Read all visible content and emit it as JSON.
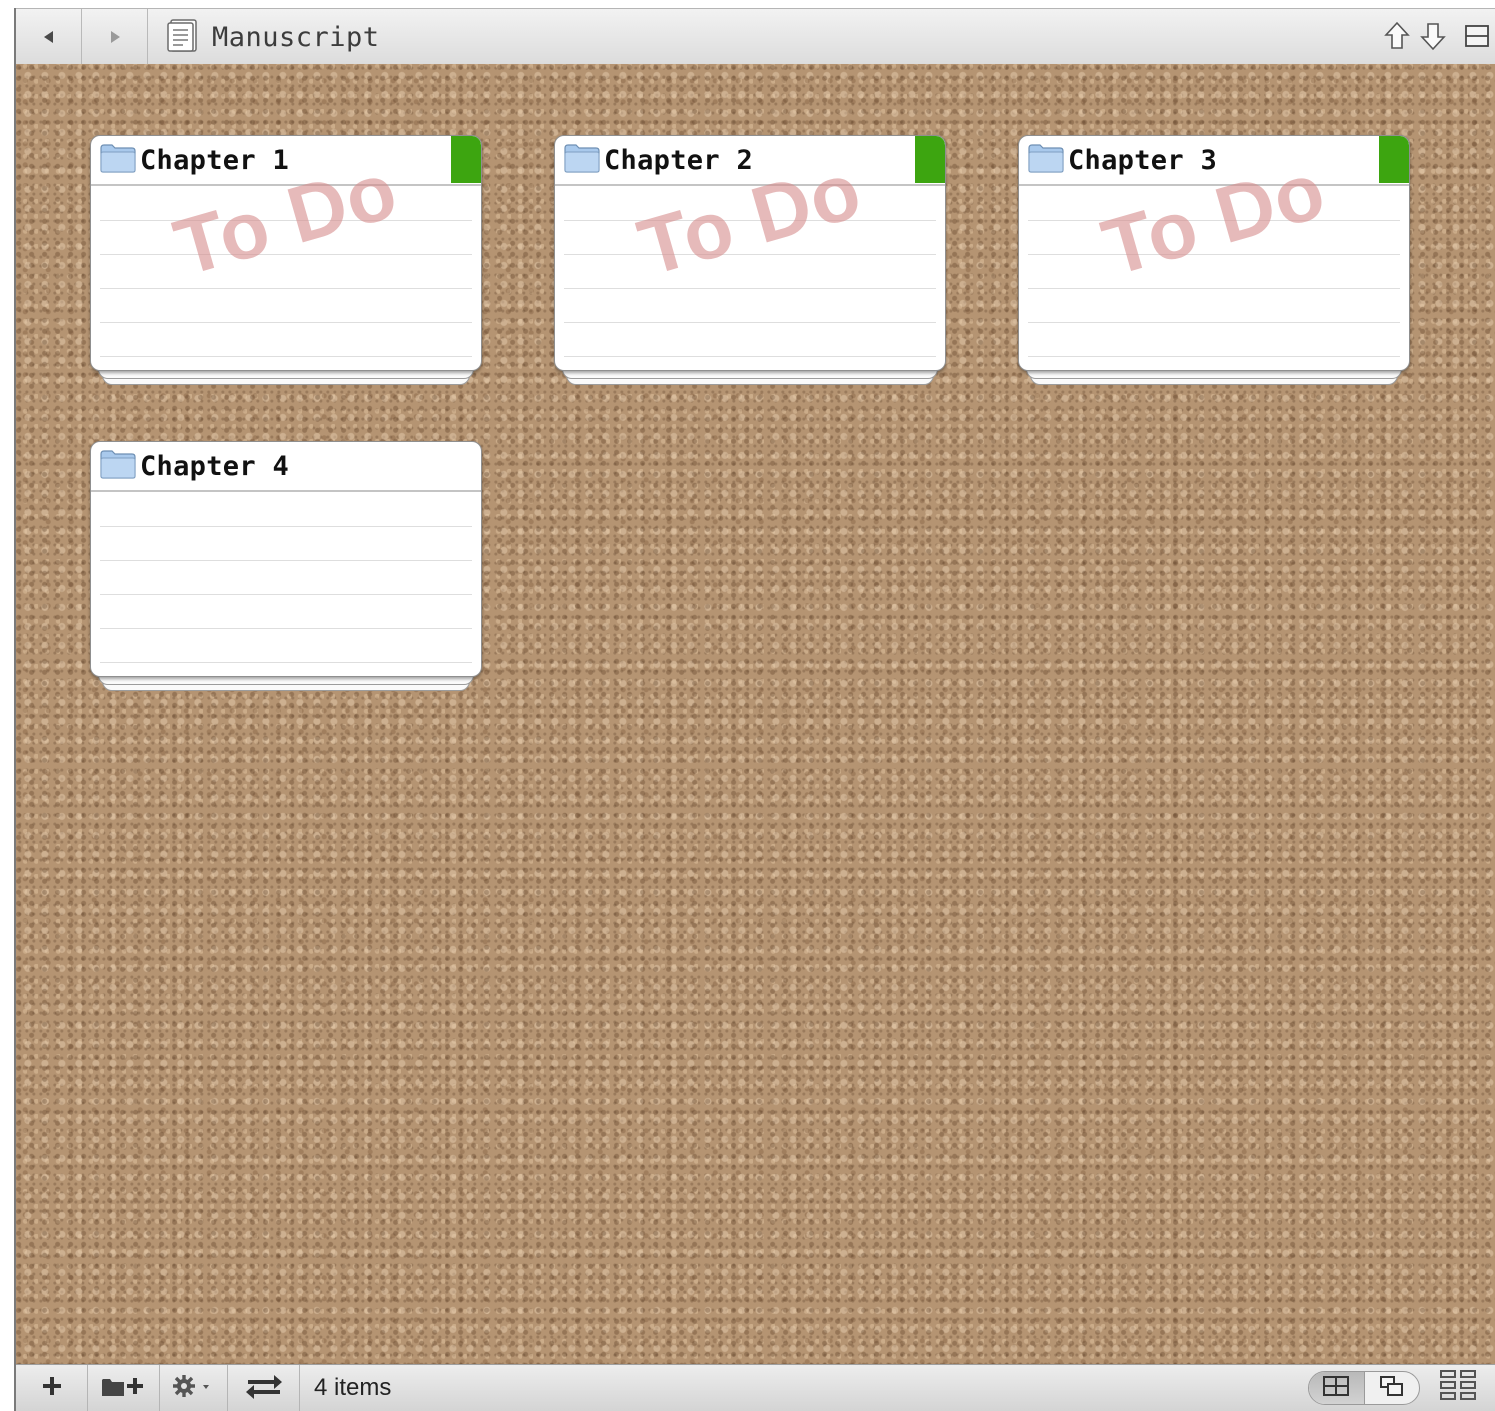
{
  "header": {
    "title": "Manuscript",
    "back_icon": "back-arrow-icon",
    "forward_icon": "forward-arrow-icon",
    "doc_icon": "document-icon",
    "right_icons": [
      "up-arrow-icon",
      "down-arrow-icon",
      "split-view-icon"
    ]
  },
  "cards": [
    {
      "title": "Chapter 1",
      "stamp": "To Do",
      "label_color": "#3da510"
    },
    {
      "title": "Chapter 2",
      "stamp": "To Do",
      "label_color": "#3da510"
    },
    {
      "title": "Chapter 3",
      "stamp": "To Do",
      "label_color": "#3da510"
    },
    {
      "title": "Chapter 4",
      "stamp": "",
      "label_color": ""
    }
  ],
  "footer": {
    "add_label": "+",
    "add_folder_label": "+",
    "status": "4 items",
    "icons": [
      "plus-icon",
      "add-folder-icon",
      "gear-icon",
      "swap-arrows-icon",
      "corkboard-view-icon",
      "freeform-view-icon",
      "grid-icon"
    ]
  },
  "colors": {
    "cork": "#b59472",
    "label_green": "#3da510",
    "stamp_pink": "#d68c8c"
  }
}
